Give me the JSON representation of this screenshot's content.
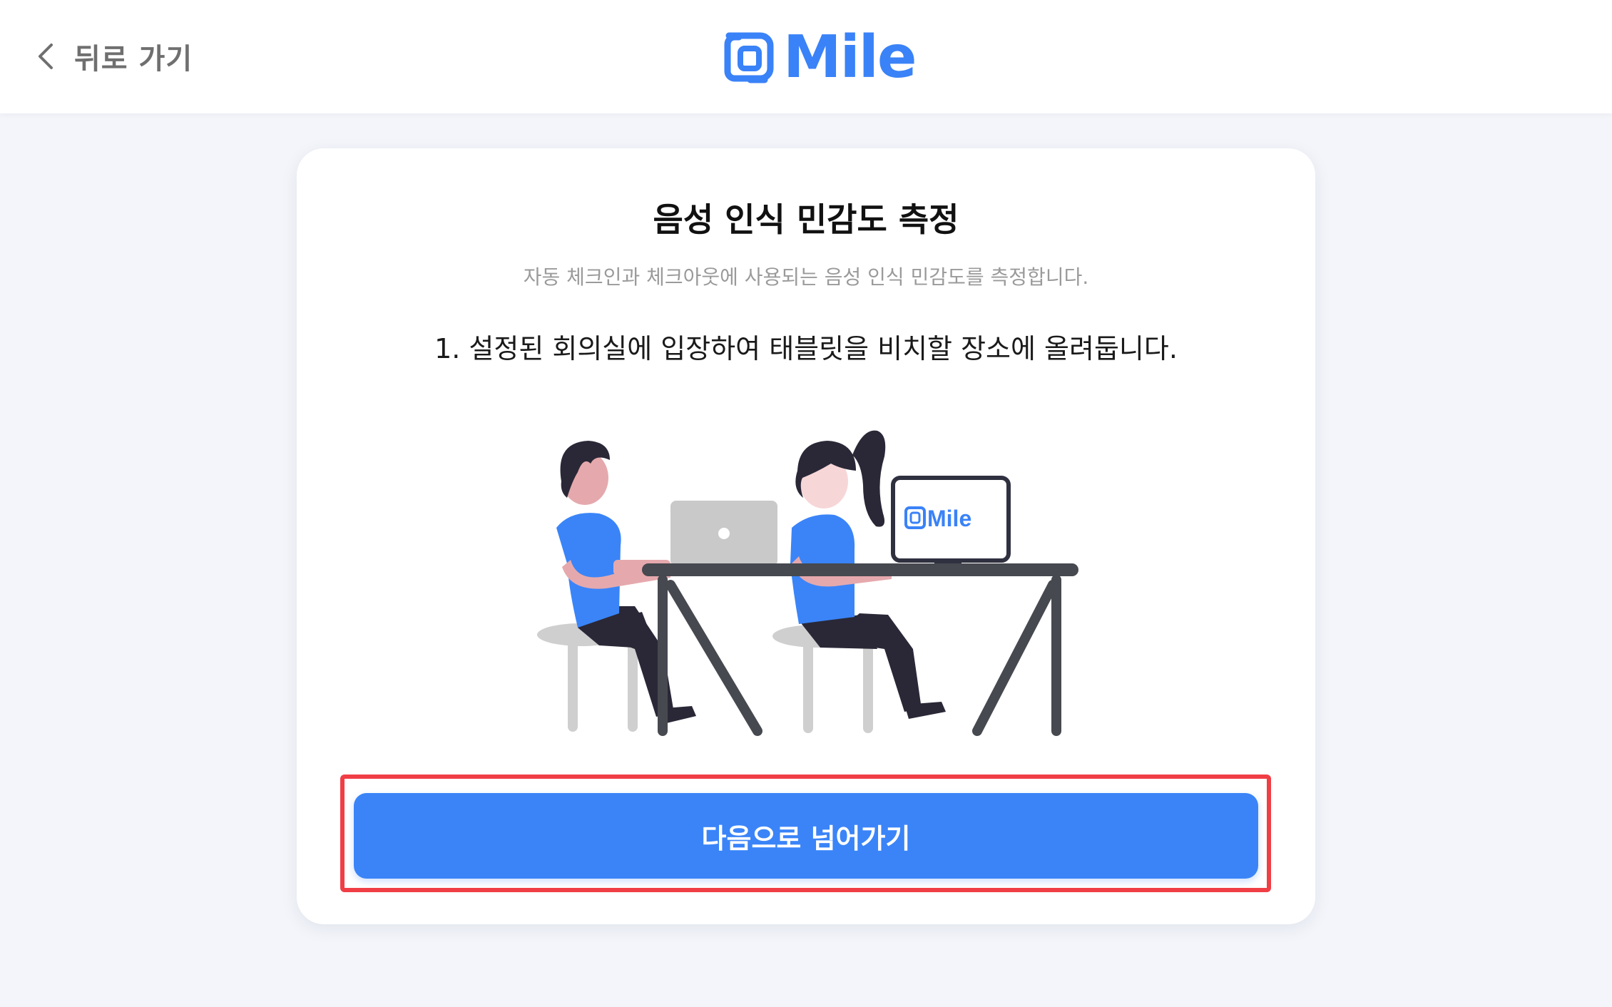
{
  "header": {
    "back_label": "뒤로 가기",
    "logo_text": "Mile",
    "brand_color": "#3a82f7"
  },
  "card": {
    "title": "음성 인식 민감도 측정",
    "subtitle": "자동 체크인과 체크아웃에 사용되는 음성 인식 민감도를 측정합니다.",
    "step_text": "1. 설정된 회의실에 입장하여 태블릿을 비치할 장소에 올려둡니다.",
    "illustration": {
      "monitor_logo_text": "Mile"
    },
    "next_button_label": "다음으로 넘어가기"
  },
  "colors": {
    "primary": "#3a84f8",
    "highlight_border": "#f03e45",
    "background": "#f3f5fa"
  }
}
